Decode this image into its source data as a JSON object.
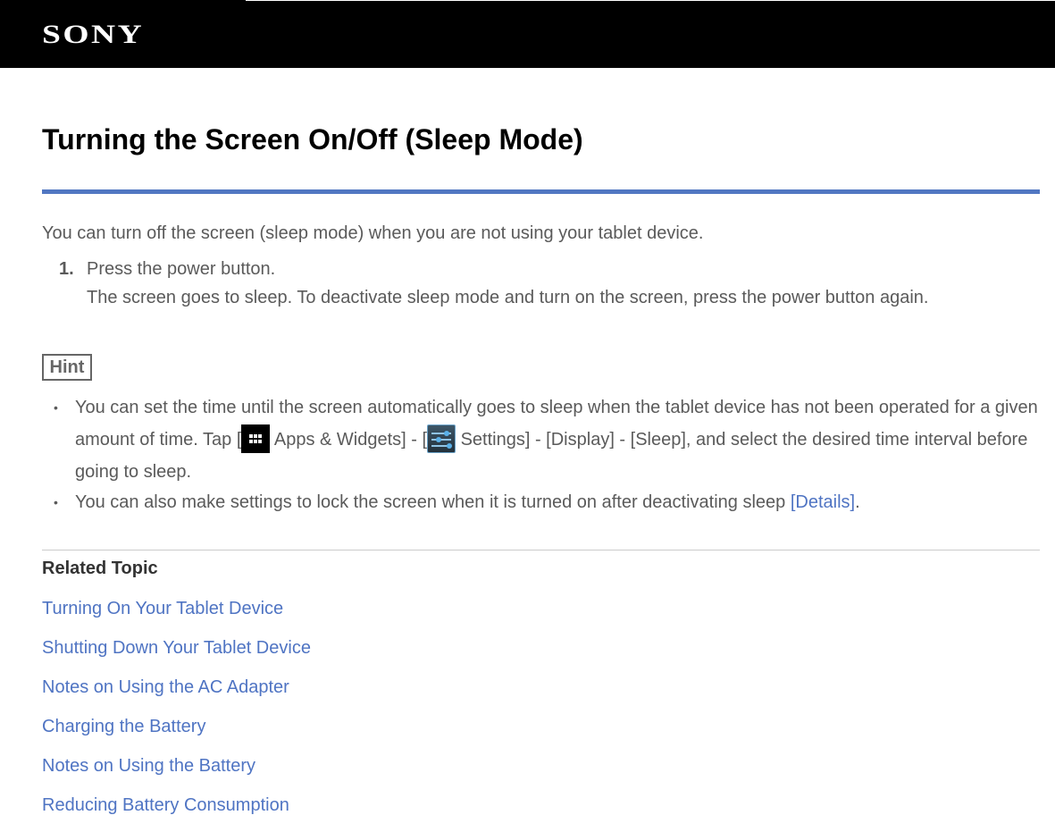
{
  "header": {
    "logo": "SONY"
  },
  "page": {
    "title": "Turning the Screen On/Off (Sleep Mode)",
    "intro": "You can turn off the screen (sleep mode) when you are not using your tablet device.",
    "steps": [
      {
        "number": "1.",
        "text": "Press the power button.",
        "detail": "The screen goes to sleep. To deactivate sleep mode and turn on the screen, press the power button again."
      }
    ]
  },
  "hint": {
    "label": "Hint",
    "bullet_char": "•",
    "items": [
      {
        "part1": "You can set the time until the screen automatically goes to sleep when the tablet device has not been operated for a given amount of time. Tap [",
        "apps_icon": "apps-grid-icon",
        "part2": " Apps & Widgets] - [",
        "settings_icon": "settings-sliders-icon",
        "part3": " Settings] - [Display] - [Sleep], and select the desired time interval before going to sleep."
      },
      {
        "text": "You can also make settings to lock the screen when it is turned on after deactivating sleep ",
        "link": "[Details]",
        "end": "."
      }
    ]
  },
  "related": {
    "title": "Related Topic",
    "links": [
      "Turning On Your Tablet Device",
      "Shutting Down Your Tablet Device",
      "Notes on Using the AC Adapter",
      "Charging the Battery",
      "Notes on Using the Battery",
      "Reducing Battery Consumption"
    ]
  },
  "colors": {
    "accent": "#5177c2",
    "link": "#4f74c3",
    "text": "#5a5a5a",
    "header_bg": "#000000"
  }
}
